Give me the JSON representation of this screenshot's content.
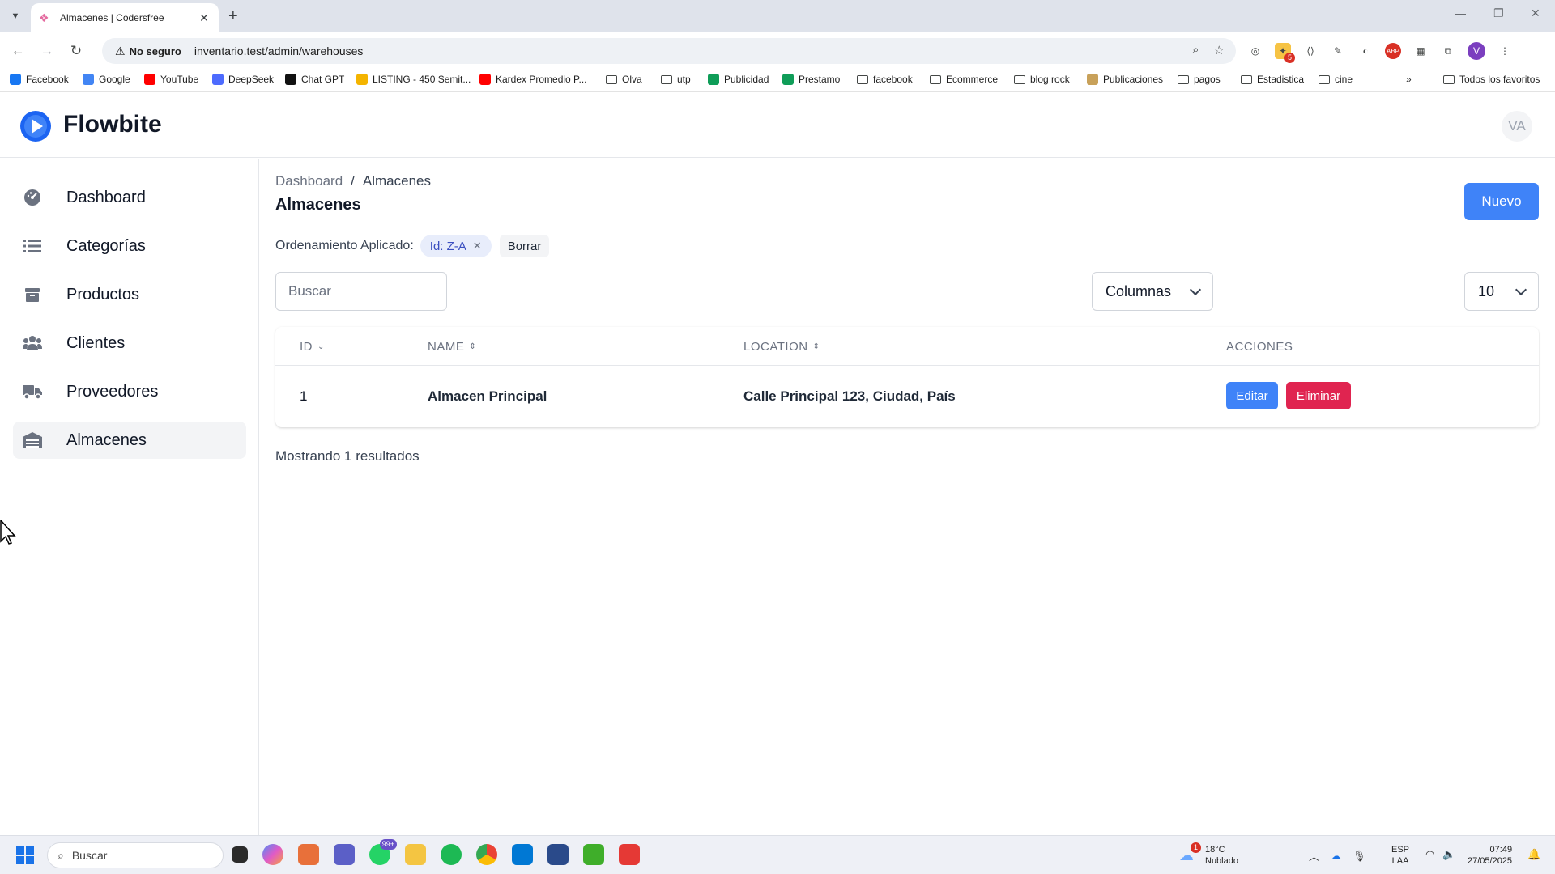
{
  "browser": {
    "tab_title": "Almacenes | Codersfree",
    "tab_favicon": "laravel-icon",
    "security_label": "No seguro",
    "url": "inventario.test/admin/warehouses",
    "profile_initial": "V",
    "extension_badge": "5",
    "bookmarks": [
      {
        "label": "Facebook",
        "icon": "facebook-icon",
        "color": "#1877f2"
      },
      {
        "label": "Google",
        "icon": "google-icon",
        "color": "#4285f4"
      },
      {
        "label": "YouTube",
        "icon": "youtube-icon",
        "color": "#ff0000"
      },
      {
        "label": "DeepSeek",
        "icon": "deepseek-icon",
        "color": "#4d6bfe"
      },
      {
        "label": "Chat GPT",
        "icon": "chatgpt-icon",
        "color": "#111111"
      },
      {
        "label": "LISTING - 450 Semit...",
        "icon": "drive-icon",
        "color": "#f4b400"
      },
      {
        "label": "Kardex Promedio P...",
        "icon": "youtube-icon",
        "color": "#ff0000"
      },
      {
        "label": "Olva",
        "icon": "folder-icon"
      },
      {
        "label": "utp",
        "icon": "folder-icon"
      },
      {
        "label": "Publicidad",
        "icon": "sheets-icon",
        "color": "#0f9d58"
      },
      {
        "label": "Prestamo",
        "icon": "sheets-icon",
        "color": "#0f9d58"
      },
      {
        "label": "facebook",
        "icon": "folder-icon"
      },
      {
        "label": "Ecommerce",
        "icon": "folder-icon"
      },
      {
        "label": "blog rock",
        "icon": "folder-icon"
      },
      {
        "label": "Publicaciones",
        "icon": "publicaciones-icon",
        "color": "#c8a15a"
      },
      {
        "label": "pagos",
        "icon": "folder-icon"
      },
      {
        "label": "Estadistica",
        "icon": "folder-icon"
      },
      {
        "label": "cine",
        "icon": "folder-icon"
      }
    ],
    "all_bookmarks_label": "Todos los favoritos"
  },
  "app": {
    "brand": "Flowbite",
    "avatar_initials": "VA",
    "accent_color": "#3f83f8",
    "danger_color": "#e02450"
  },
  "sidebar": {
    "items": [
      {
        "label": "Dashboard",
        "icon": "gauge-icon",
        "active": false
      },
      {
        "label": "Categorías",
        "icon": "list-icon",
        "active": false
      },
      {
        "label": "Productos",
        "icon": "box-icon",
        "active": false
      },
      {
        "label": "Clientes",
        "icon": "users-icon",
        "active": false
      },
      {
        "label": "Proveedores",
        "icon": "truck-icon",
        "active": false
      },
      {
        "label": "Almacenes",
        "icon": "warehouse-icon",
        "active": true
      }
    ]
  },
  "main": {
    "breadcrumb": {
      "home": "Dashboard",
      "separator": "/",
      "current": "Almacenes"
    },
    "title": "Almacenes",
    "new_button": "Nuevo",
    "sorting": {
      "label": "Ordenamiento Aplicado:",
      "chip": "Id: Z-A",
      "clear": "Borrar"
    },
    "search": {
      "placeholder": "Buscar",
      "value": ""
    },
    "columns_select": "Columnas",
    "per_page_select": "10",
    "table": {
      "headers": {
        "id": "ID",
        "name": "NAME",
        "location": "LOCATION",
        "actions": "ACCIONES"
      },
      "rows": [
        {
          "id": "1",
          "name": "Almacen Principal",
          "location": "Calle Principal 123, Ciudad, País"
        }
      ],
      "edit_label": "Editar",
      "delete_label": "Eliminar"
    },
    "results_text": "Mostrando 1 resultados"
  },
  "taskbar": {
    "search_placeholder": "Buscar",
    "whatsapp_badge": "99+",
    "weather_badge": "1",
    "temperature": "18°C",
    "condition": "Nublado",
    "language_top": "ESP",
    "language_bottom": "LAA",
    "time": "07:49",
    "date": "27/05/2025"
  }
}
